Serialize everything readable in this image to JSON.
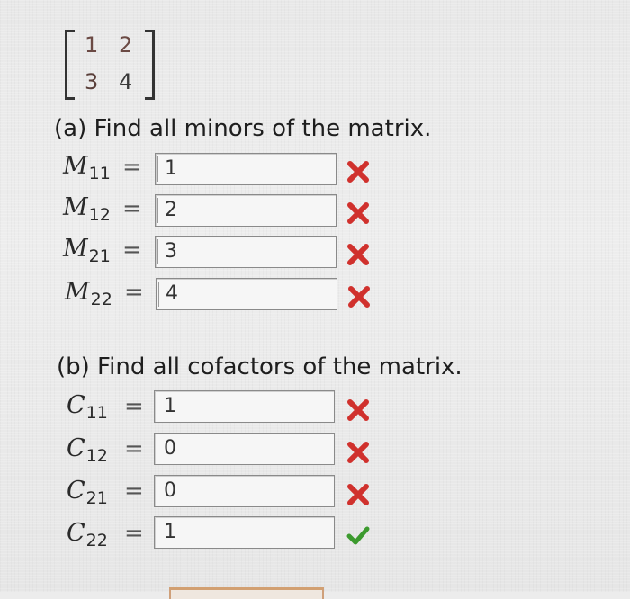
{
  "matrix": {
    "r1c1": "1",
    "r1c2": "2",
    "r2c1": "3",
    "r2c2": "4"
  },
  "part_a": {
    "heading": "(a) Find all minors of the matrix.",
    "rows": [
      {
        "symbol": "M",
        "subscript": "11",
        "eq": "=",
        "value": "1",
        "status": "incorrect"
      },
      {
        "symbol": "M",
        "subscript": "12",
        "eq": "=",
        "value": "2",
        "status": "incorrect"
      },
      {
        "symbol": "M",
        "subscript": "21",
        "eq": "=",
        "value": "3",
        "status": "incorrect"
      },
      {
        "symbol": "M",
        "subscript": "22",
        "eq": "=",
        "value": "4",
        "status": "incorrect"
      }
    ]
  },
  "part_b": {
    "heading": "(b) Find all cofactors of the matrix.",
    "rows": [
      {
        "symbol": "C",
        "subscript": "11",
        "eq": "=",
        "value": "1",
        "status": "incorrect"
      },
      {
        "symbol": "C",
        "subscript": "12",
        "eq": "=",
        "value": "0",
        "status": "incorrect"
      },
      {
        "symbol": "C",
        "subscript": "21",
        "eq": "=",
        "value": "0",
        "status": "incorrect"
      },
      {
        "symbol": "C",
        "subscript": "22",
        "eq": "=",
        "value": "1",
        "status": "correct"
      }
    ]
  },
  "colors": {
    "incorrect": "#d0312d",
    "correct": "#3c9a2e",
    "field_border": "#8a8a8a"
  },
  "icons": {
    "incorrect": "x-mark-icon",
    "correct": "check-mark-icon"
  }
}
